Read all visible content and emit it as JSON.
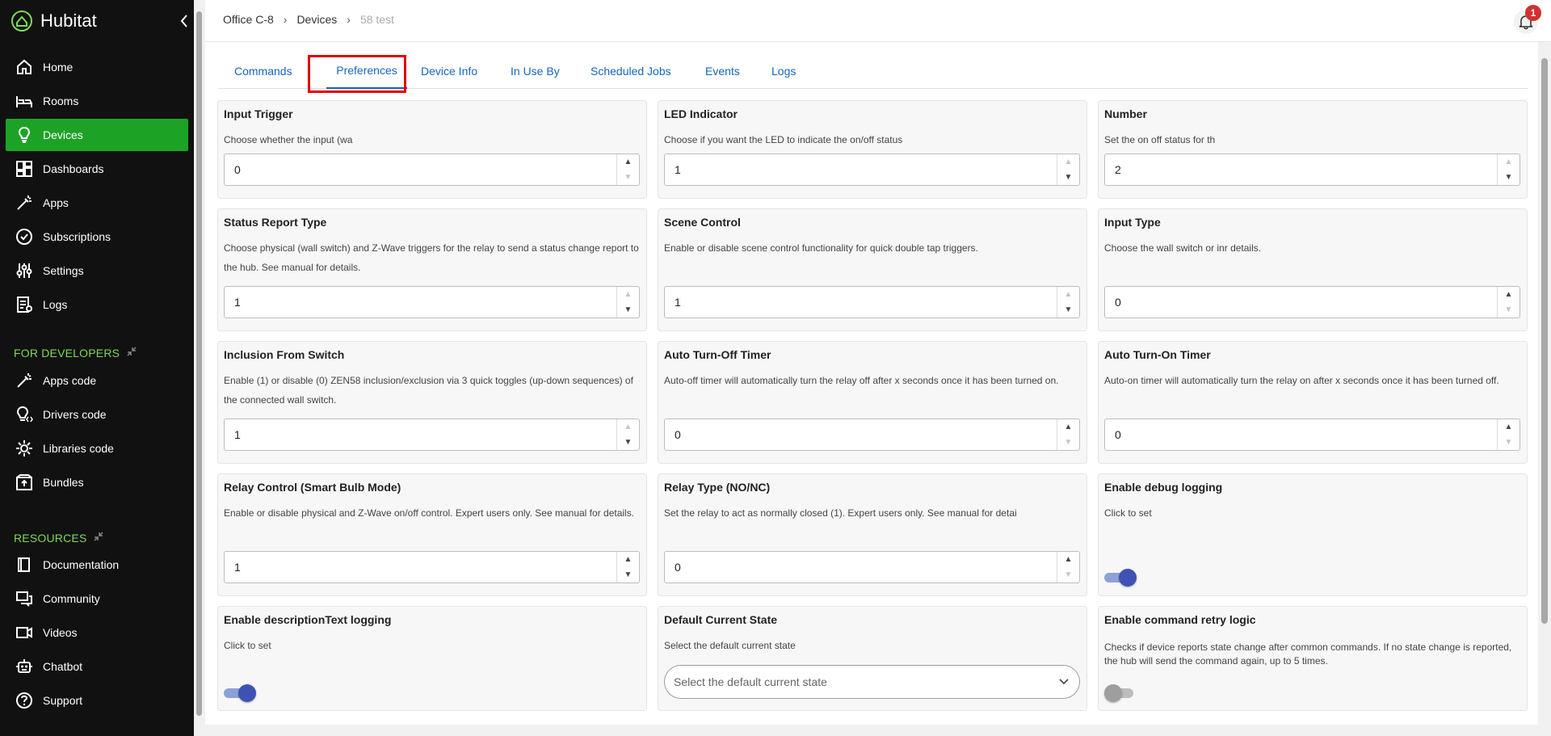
{
  "app": {
    "name": "Hubitat"
  },
  "sidebar": {
    "items": [
      {
        "label": "Home",
        "icon": "home-icon"
      },
      {
        "label": "Rooms",
        "icon": "bed-icon"
      },
      {
        "label": "Devices",
        "icon": "lightbulb-icon",
        "active": true
      },
      {
        "label": "Dashboards",
        "icon": "dashboard-icon"
      },
      {
        "label": "Apps",
        "icon": "magic-wand-icon"
      },
      {
        "label": "Subscriptions",
        "icon": "check-circle-icon"
      },
      {
        "label": "Settings",
        "icon": "sliders-icon"
      },
      {
        "label": "Logs",
        "icon": "log-icon"
      }
    ],
    "dev_section": "FOR DEVELOPERS",
    "dev_items": [
      {
        "label": "Apps code",
        "icon": "magic-wand-icon"
      },
      {
        "label": "Drivers code",
        "icon": "bulb-code-icon"
      },
      {
        "label": "Libraries code",
        "icon": "gear-icon"
      },
      {
        "label": "Bundles",
        "icon": "package-icon"
      }
    ],
    "res_section": "RESOURCES",
    "res_items": [
      {
        "label": "Documentation",
        "icon": "book-icon"
      },
      {
        "label": "Community",
        "icon": "chat-icon"
      },
      {
        "label": "Videos",
        "icon": "video-icon"
      },
      {
        "label": "Chatbot",
        "icon": "robot-icon"
      },
      {
        "label": "Support",
        "icon": "help-icon"
      }
    ]
  },
  "breadcrumb": {
    "hub": "Office C-8",
    "section": "Devices",
    "device": "58 test"
  },
  "notifications": {
    "count": "1"
  },
  "tabs": [
    "Commands",
    "Preferences",
    "Device Info",
    "In Use By",
    "Scheduled Jobs",
    "Events",
    "Logs"
  ],
  "active_tab": "Preferences",
  "prefs": {
    "input_trigger": {
      "title": "Input Trigger",
      "desc": "Choose whether the input (wa",
      "value": "0"
    },
    "led_indicator": {
      "title": "LED Indicator",
      "desc": "Choose if you want the LED to indicate the on/off status",
      "value": "1"
    },
    "number": {
      "title": "Number",
      "desc": "Set the on off status for th",
      "value": "2"
    },
    "status_report": {
      "title": "Status Report Type",
      "desc": "Choose physical (wall switch) and Z-Wave triggers for the relay to send a status change report to the hub. See manual for details.",
      "value": "1"
    },
    "scene_control": {
      "title": "Scene Control",
      "desc": "Enable or disable scene control functionality for quick double tap triggers.",
      "value": "1"
    },
    "input_type": {
      "title": "Input Type",
      "desc": "Choose the wall switch or inr details.",
      "value": "0"
    },
    "inclusion": {
      "title": "Inclusion From Switch",
      "desc": "Enable (1) or disable (0) ZEN58 inclusion/exclusion via 3 quick toggles (up-down sequences) of the connected wall switch.",
      "value": "1"
    },
    "auto_off": {
      "title": "Auto Turn-Off Timer",
      "desc": "Auto-off timer will automatically turn the relay off after x seconds once it has been turned on.",
      "value": "0"
    },
    "auto_on": {
      "title": "Auto Turn-On Timer",
      "desc": "Auto-on timer will automatically turn the relay on after x seconds once it has been turned off.",
      "value": "0"
    },
    "relay_control": {
      "title": "Relay Control (Smart Bulb Mode)",
      "desc": "Enable or disable physical and Z-Wave on/off control. Expert users only. See manual for details.",
      "value": "1"
    },
    "relay_type": {
      "title": "Relay Type (NO/NC)",
      "desc": "Set the relay to act as normally closed (1). Expert users only. See manual for detai",
      "value": "0"
    },
    "debug_logging": {
      "title": "Enable debug logging",
      "desc": "Click to set",
      "enabled": true
    },
    "desc_logging": {
      "title": "Enable descriptionText logging",
      "desc": "Click to set",
      "enabled": true
    },
    "default_state": {
      "title": "Default Current State",
      "desc": "Select the default current state",
      "placeholder": "Select the default current state"
    },
    "retry_logic": {
      "title": "Enable command retry logic",
      "desc": "Checks if device reports state change after common commands. If no state change is reported, the hub will send the command again, up to 5 times.",
      "enabled": false
    }
  },
  "colors": {
    "accent": "#1ca326",
    "link": "#1565c0",
    "toggle_on": "#3f51b5",
    "highlight": "#e00000"
  }
}
